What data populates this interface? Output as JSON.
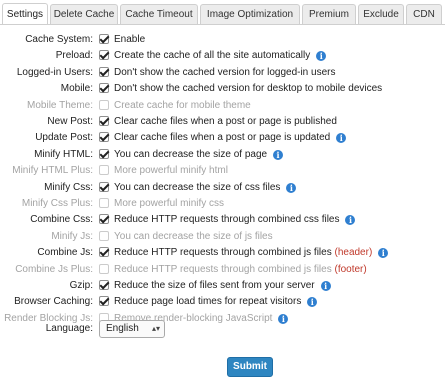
{
  "tabs": [
    "Settings",
    "Delete Cache",
    "Cache Timeout",
    "Image Optimization",
    "Premium",
    "Exclude",
    "CDN"
  ],
  "settings": [
    {
      "label": "Cache System:",
      "text": "Enable",
      "checked": true,
      "disabled": false,
      "info": false
    },
    {
      "label": "Preload:",
      "text": "Create the cache of all the site automatically",
      "checked": true,
      "disabled": false,
      "info": true
    },
    {
      "label": "Logged-in Users:",
      "text": "Don't show the cached version for logged-in users",
      "checked": true,
      "disabled": false,
      "info": false
    },
    {
      "label": "Mobile:",
      "text": "Don't show the cached version for desktop to mobile devices",
      "checked": true,
      "disabled": false,
      "info": false
    },
    {
      "label": "Mobile Theme:",
      "text": "Create cache for mobile theme",
      "checked": false,
      "disabled": true,
      "info": false
    },
    {
      "label": "New Post:",
      "text": "Clear cache files when a post or page is published",
      "checked": true,
      "disabled": false,
      "info": false
    },
    {
      "label": "Update Post:",
      "text": "Clear cache files when a post or page is updated",
      "checked": true,
      "disabled": false,
      "info": true
    },
    {
      "label": "Minify HTML:",
      "text": "You can decrease the size of page",
      "checked": true,
      "disabled": false,
      "info": true
    },
    {
      "label": "Minify HTML Plus:",
      "text": "More powerful minify html",
      "checked": false,
      "disabled": true,
      "info": false
    },
    {
      "label": "Minify Css:",
      "text": "You can decrease the size of css files",
      "checked": true,
      "disabled": false,
      "info": true
    },
    {
      "label": "Minify Css Plus:",
      "text": "More powerful minify css",
      "checked": false,
      "disabled": true,
      "info": false
    },
    {
      "label": "Combine Css:",
      "text": "Reduce HTTP requests through combined css files",
      "checked": true,
      "disabled": false,
      "info": true
    },
    {
      "label": "Minify Js:",
      "text": "You can decrease the size of js files",
      "checked": false,
      "disabled": true,
      "info": false
    },
    {
      "label": "Combine Js:",
      "text": "Reduce HTTP requests through combined js files",
      "tag": "(header)",
      "checked": true,
      "disabled": false,
      "info": true
    },
    {
      "label": "Combine Js Plus:",
      "text": "Reduce HTTP requests through combined js files",
      "tag": "(footer)",
      "checked": false,
      "disabled": true,
      "info": false
    },
    {
      "label": "Gzip:",
      "text": "Reduce the size of files sent from your server",
      "checked": true,
      "disabled": false,
      "info": true
    },
    {
      "label": "Browser Caching:",
      "text": "Reduce page load times for repeat visitors",
      "checked": true,
      "disabled": false,
      "info": true
    },
    {
      "label": "Render Blocking Js:",
      "text": "Remove render-blocking JavaScript",
      "checked": false,
      "disabled": true,
      "info": true
    }
  ],
  "language": {
    "label": "Language:",
    "value": "English"
  },
  "submit_label": "Submit"
}
